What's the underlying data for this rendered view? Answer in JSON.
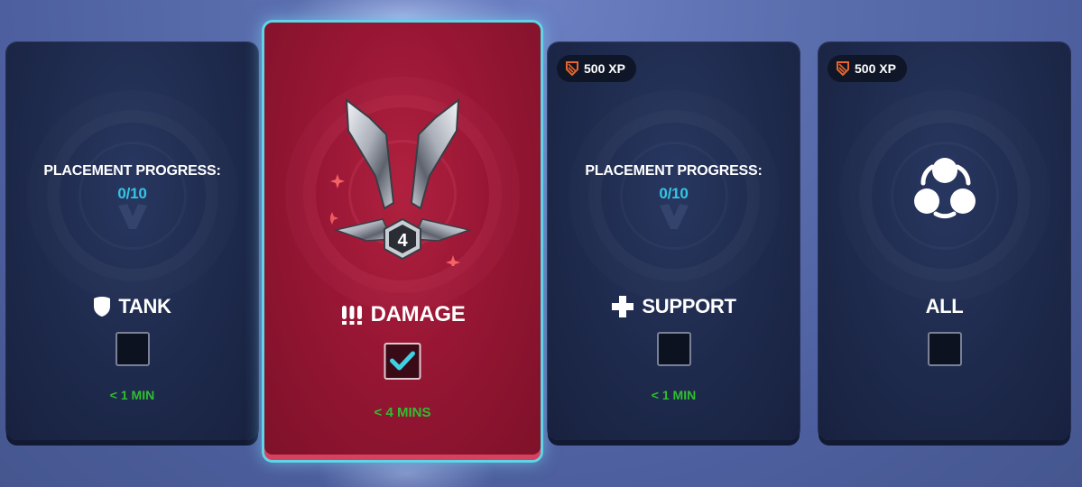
{
  "roles": [
    {
      "id": "tank",
      "label": "TANK",
      "icon": "shield-icon",
      "placement_label": "PLACEMENT PROGRESS:",
      "placement_value": "0/10",
      "checked": false,
      "wait": "< 1 MIN",
      "xp": ""
    },
    {
      "id": "damage",
      "label": "DAMAGE",
      "icon": "damage-bullets-icon",
      "rank_tier": "4",
      "checked": true,
      "wait": "< 4 MINS",
      "xp": ""
    },
    {
      "id": "support",
      "label": "SUPPORT",
      "icon": "plus-cross-icon",
      "placement_label": "PLACEMENT PROGRESS:",
      "placement_value": "0/10",
      "checked": false,
      "wait": "< 1 MIN",
      "xp": "500 XP"
    },
    {
      "id": "all",
      "label": "ALL",
      "icon": "all-roles-icon",
      "checked": false,
      "wait": "",
      "xp": "500 XP"
    }
  ],
  "colors": {
    "selected_card": "#971634",
    "selected_border": "#5fd4e6",
    "placement_value": "#33c6e6",
    "wait_time": "#2fbf2f",
    "xp_icon": "#e8642a",
    "checkmark": "#3fd0e4"
  }
}
